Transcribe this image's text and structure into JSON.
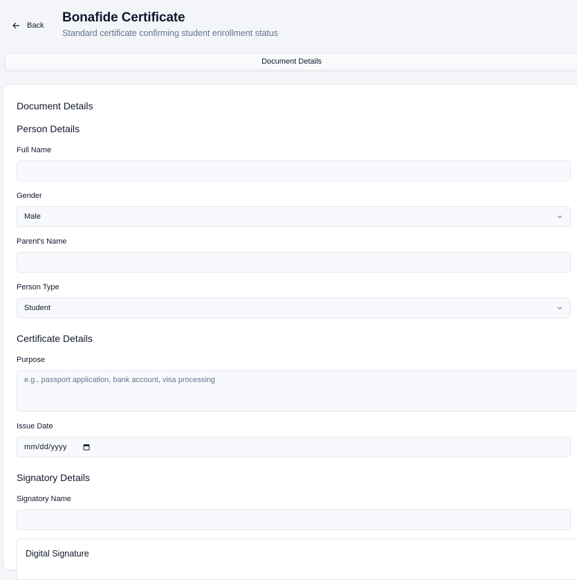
{
  "header": {
    "back_label": "Back",
    "title": "Bonafide Certificate",
    "subtitle": "Standard certificate confirming student enrollment status"
  },
  "tabs": [
    {
      "label": "Document Details",
      "active": true
    }
  ],
  "form": {
    "heading": "Document Details",
    "person_section": {
      "heading": "Person Details",
      "full_name": {
        "label": "Full Name",
        "value": ""
      },
      "gender": {
        "label": "Gender",
        "value": "Male"
      },
      "parent_name": {
        "label": "Parent's Name",
        "value": ""
      },
      "person_type": {
        "label": "Person Type",
        "value": "Student"
      }
    },
    "certificate_section": {
      "heading": "Certificate Details",
      "purpose": {
        "label": "Purpose",
        "placeholder": "e.g., passport application, bank account, visa processing",
        "value": ""
      },
      "issue_date": {
        "label": "Issue Date",
        "value": "mm/dd/yyyy"
      }
    },
    "signatory_section": {
      "heading": "Signatory Details",
      "signatory_name": {
        "label": "Signatory Name",
        "value": ""
      },
      "digital_signature": {
        "heading": "Digital Signature"
      }
    }
  },
  "icons": {
    "back": "arrow-left-icon",
    "select": "chevron-down-icon",
    "date": "calendar-icon"
  },
  "colors": {
    "background": "#f3f5f9",
    "card": "#ffffff",
    "input_bg": "#f8f9fc",
    "border": "#e3e7ee",
    "text": "#0f172a",
    "muted": "#64748b"
  }
}
